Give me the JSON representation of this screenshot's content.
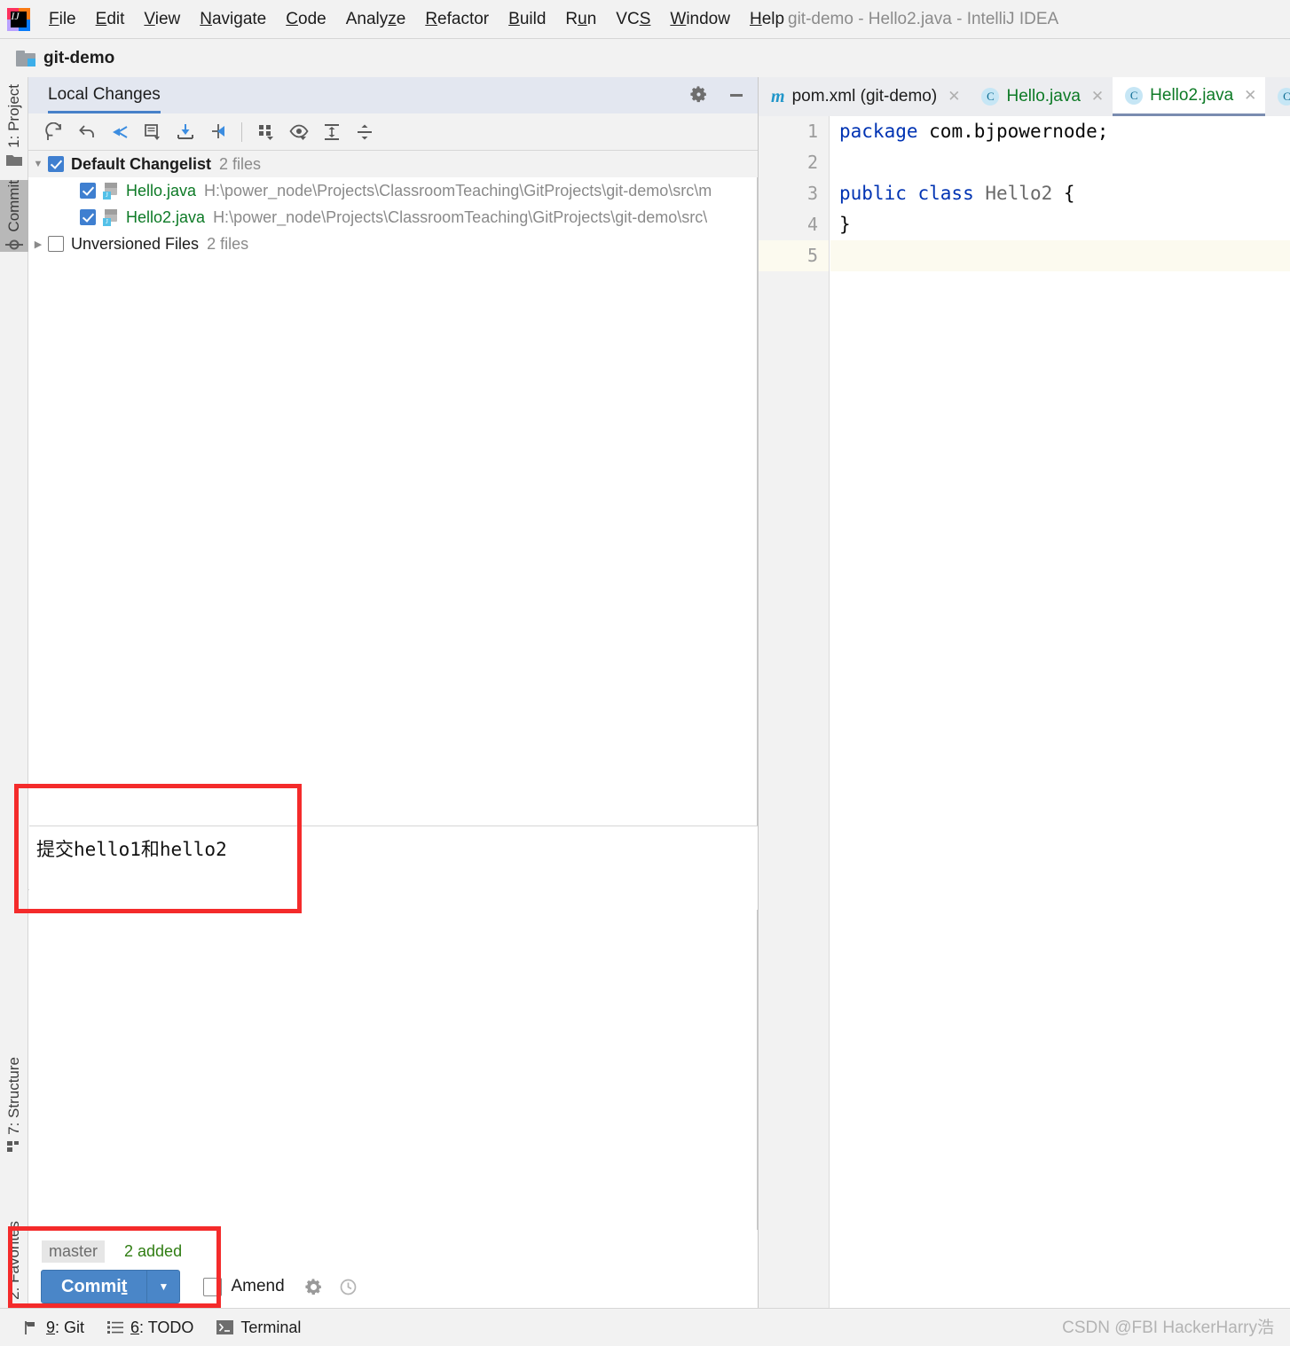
{
  "window": {
    "title": "git-demo - Hello2.java - IntelliJ IDEA",
    "logo_name": "intellij-idea-logo"
  },
  "menubar": {
    "items": [
      {
        "label": "File",
        "mnemonic": "F"
      },
      {
        "label": "Edit",
        "mnemonic": "E"
      },
      {
        "label": "View",
        "mnemonic": "V"
      },
      {
        "label": "Navigate",
        "mnemonic": "N"
      },
      {
        "label": "Code",
        "mnemonic": "C"
      },
      {
        "label": "Analyze",
        "mnemonic": "z"
      },
      {
        "label": "Refactor",
        "mnemonic": "R"
      },
      {
        "label": "Build",
        "mnemonic": "B"
      },
      {
        "label": "Run",
        "mnemonic": "u"
      },
      {
        "label": "VCS",
        "mnemonic": "S"
      },
      {
        "label": "Window",
        "mnemonic": "W"
      },
      {
        "label": "Help",
        "mnemonic": "H"
      }
    ]
  },
  "project_header": {
    "name": "git-demo",
    "icon": "project-folder-icon"
  },
  "left_stripe": {
    "top_items": [
      {
        "label": "1: Project",
        "icon": "folder-icon",
        "active": false
      },
      {
        "label": "Commit",
        "icon": "commit-node-icon",
        "active": true
      }
    ],
    "bottom_items": [
      {
        "label": "7: Structure",
        "icon": "structure-icon",
        "active": false
      },
      {
        "label": "2: Favorites",
        "icon": "star-icon",
        "active": false
      }
    ]
  },
  "local_changes": {
    "tab_label": "Local Changes",
    "header_actions": [
      {
        "name": "settings-gear",
        "icon": "gear-icon"
      },
      {
        "name": "hide-panel",
        "icon": "minimize-icon"
      }
    ],
    "toolbar": [
      {
        "name": "refresh",
        "icon": "refresh-icon"
      },
      {
        "name": "rollback",
        "icon": "undo-arrow-icon"
      },
      {
        "name": "show-diff",
        "icon": "diff-arrow-icon"
      },
      {
        "name": "create-patch",
        "icon": "note-dropdown-icon"
      },
      {
        "name": "shelve-changes",
        "icon": "download-tray-icon"
      },
      {
        "name": "move-to-changelist",
        "icon": "move-changes-icon"
      },
      {
        "name": "group-by",
        "icon": "group-by-icon"
      },
      {
        "name": "preview-diff",
        "icon": "eye-dropdown-icon"
      },
      {
        "name": "expand-all",
        "icon": "expand-all-icon"
      },
      {
        "name": "collapse-all",
        "icon": "collapse-all-icon"
      }
    ],
    "tree": {
      "changelist": {
        "name": "Default Changelist",
        "count_label": "2 files",
        "checked": true,
        "expanded": true
      },
      "files": [
        {
          "name": "Hello.java",
          "path": "H:\\power_node\\Projects\\ClassroomTeaching\\GitProjects\\git-demo\\src\\m",
          "checked": true,
          "icon": "java-file-icon"
        },
        {
          "name": "Hello2.java",
          "path": "H:\\power_node\\Projects\\ClassroomTeaching\\GitProjects\\git-demo\\src\\",
          "checked": true,
          "icon": "java-file-icon"
        }
      ],
      "unversioned": {
        "name": "Unversioned Files",
        "count_label": "2 files",
        "checked": false,
        "expanded": false
      }
    },
    "commit_message": {
      "value": "提交hello1和hello2",
      "placeholder": ""
    },
    "footer": {
      "branch": "master",
      "stats": "2 added",
      "commit_button": "Commit",
      "commit_mnemonic": "t",
      "dropdown_icon": "chevron-down-icon",
      "amend_label": "Amend",
      "amend_checked": false,
      "gear_icon": "gear-icon",
      "history_icon": "clock-icon"
    }
  },
  "editor": {
    "tabs": [
      {
        "label": "pom.xml (git-demo)",
        "icon": "maven-m-icon",
        "active": false,
        "color": "dark"
      },
      {
        "label": "Hello.java",
        "icon": "class-c-icon",
        "active": false,
        "color": "green"
      },
      {
        "label": "Hello2.java",
        "icon": "class-c-icon",
        "active": true,
        "color": "green"
      }
    ],
    "close_icon": "close-x-icon",
    "gutter": [
      "1",
      "2",
      "3",
      "4",
      "5"
    ],
    "caret_line": 5,
    "code": [
      {
        "n": 1,
        "tokens": [
          {
            "t": "package",
            "c": "kw"
          },
          {
            "t": " com.bjpowernode;",
            "c": "pl"
          }
        ]
      },
      {
        "n": 2,
        "tokens": [
          {
            "t": "",
            "c": "pl"
          }
        ]
      },
      {
        "n": 3,
        "tokens": [
          {
            "t": "public class ",
            "c": "kw"
          },
          {
            "t": "Hello2",
            "c": "cls"
          },
          {
            "t": " {",
            "c": "pl"
          }
        ]
      },
      {
        "n": 4,
        "tokens": [
          {
            "t": "}",
            "c": "pl"
          }
        ]
      },
      {
        "n": 5,
        "tokens": [
          {
            "t": "",
            "c": "pl"
          }
        ]
      }
    ]
  },
  "statusbar": {
    "items": [
      {
        "label": "9: Git",
        "mnemonic": "9",
        "icon": "git-branch-icon"
      },
      {
        "label": "6: TODO",
        "mnemonic": "6",
        "icon": "todo-list-icon"
      },
      {
        "label": "Terminal",
        "mnemonic": "",
        "icon": "terminal-icon"
      }
    ],
    "watermark": "CSDN @FBI HackerHarry浩"
  },
  "annotations": {
    "highlight_color": "#f42b2b",
    "boxes": [
      {
        "name": "commit-message-highlight"
      },
      {
        "name": "commit-button-highlight"
      }
    ]
  },
  "colors": {
    "accent_blue": "#4a86c8",
    "tab_underline": "#4781c9",
    "added_green": "#2f7d12",
    "file_green": "#0d7a26",
    "keyword_blue": "#0033b3",
    "panel_bg": "#f2f2f2",
    "header_bg": "#e3e7f0"
  }
}
